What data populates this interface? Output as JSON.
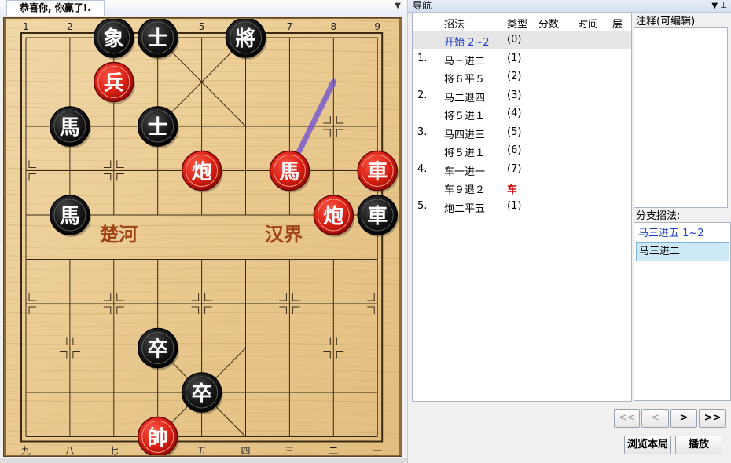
{
  "board_panel": {
    "tab_title": "恭喜你, 你赢了!.",
    "pin_icon": "dropdown-pin-icon",
    "river_left": "楚河",
    "river_right": "汉界",
    "top_numbers": [
      "1",
      "2",
      "3",
      "4",
      "5",
      "6",
      "7",
      "8",
      "9"
    ],
    "bottom_numbers": [
      "九",
      "八",
      "七",
      "六",
      "五",
      "四",
      "三",
      "二",
      "一"
    ],
    "pieces": [
      {
        "col": 2,
        "row": 0,
        "side": "black",
        "char": "象"
      },
      {
        "col": 3,
        "row": 0,
        "side": "black",
        "char": "士"
      },
      {
        "col": 5,
        "row": 0,
        "side": "black",
        "char": "將"
      },
      {
        "col": 2,
        "row": 1,
        "side": "red",
        "char": "兵"
      },
      {
        "col": 1,
        "row": 2,
        "side": "black",
        "char": "馬"
      },
      {
        "col": 3,
        "row": 2,
        "side": "black",
        "char": "士"
      },
      {
        "col": 4,
        "row": 3,
        "side": "red",
        "char": "炮"
      },
      {
        "col": 6,
        "row": 3,
        "side": "red",
        "char": "馬"
      },
      {
        "col": 8,
        "row": 3,
        "side": "red",
        "char": "車"
      },
      {
        "col": 1,
        "row": 4,
        "side": "black",
        "char": "馬"
      },
      {
        "col": 7,
        "row": 4,
        "side": "red",
        "char": "炮"
      },
      {
        "col": 8,
        "row": 4,
        "side": "black",
        "char": "車"
      },
      {
        "col": 3,
        "row": 7,
        "side": "black",
        "char": "卒"
      },
      {
        "col": 4,
        "row": 8,
        "side": "black",
        "char": "卒"
      },
      {
        "col": 3,
        "row": 9,
        "side": "red",
        "char": "帥"
      }
    ],
    "hint_arrow": {
      "from": {
        "col": 6,
        "row": 3
      },
      "to": {
        "col": 7,
        "row": 1
      },
      "color": "#6a4fd8"
    }
  },
  "nav_panel": {
    "title": "导航",
    "headers": [
      "招法",
      "类型",
      "分数",
      "时间",
      "层"
    ],
    "rows": [
      {
        "num": "",
        "move": "开始 2~2",
        "type": "(0)",
        "selected": true,
        "start": true
      },
      {
        "num": "1.",
        "move": "马三进二",
        "type": "(1)"
      },
      {
        "num": "",
        "move": "将６平５",
        "type": "(2)"
      },
      {
        "num": "2.",
        "move": "马二退四",
        "type": "(3)"
      },
      {
        "num": "",
        "move": "将５进１",
        "type": "(4)"
      },
      {
        "num": "3.",
        "move": "马四进三",
        "type": "(5)"
      },
      {
        "num": "",
        "move": "将５进１",
        "type": "(6)"
      },
      {
        "num": "4.",
        "move": "车一进一",
        "type": "(7)"
      },
      {
        "num": "",
        "move": "车９退２",
        "type": "车",
        "type_red": true
      },
      {
        "num": "5.",
        "move": "炮二平五",
        "type": "(1)"
      }
    ],
    "comment_label": "注释(可编辑)",
    "branch_label": "分支招法:",
    "branches": [
      {
        "text": "马三进五 1~2",
        "blue": true
      },
      {
        "text": "马三进二",
        "selected": true
      }
    ],
    "buttons": {
      "first": "<<",
      "prev": "<",
      "next": ">",
      "last": ">>",
      "browse": "浏览本局",
      "play": "播放"
    }
  }
}
